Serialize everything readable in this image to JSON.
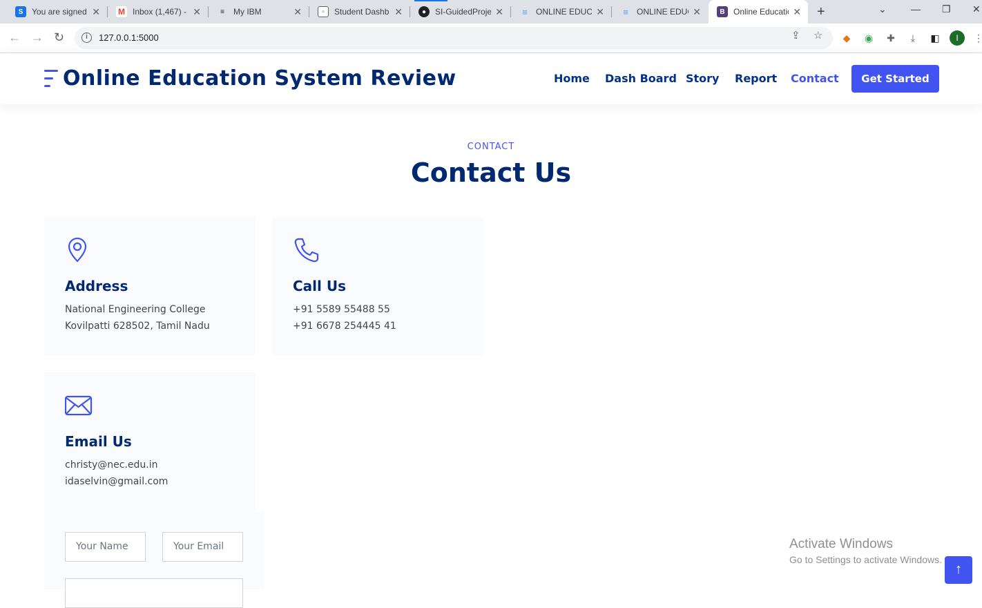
{
  "browser": {
    "tabs": [
      {
        "title": "You are signed",
        "favicon": "S",
        "favicon_color": "#1a73e8"
      },
      {
        "title": "Inbox (1,467) - ",
        "favicon": "M",
        "favicon_color": "#ea4335"
      },
      {
        "title": "My IBM",
        "favicon": "ibm",
        "favicon_color": "#202124"
      },
      {
        "title": "Student Dashb",
        "favicon": "doc",
        "favicon_color": "#5f6368"
      },
      {
        "title": "SI-GuidedProje",
        "favicon": "gh",
        "favicon_color": "#202124"
      },
      {
        "title": "ONLINE EDUCA",
        "favicon": "e",
        "favicon_color": "#4da3ff"
      },
      {
        "title": "ONLINE EDUCA",
        "favicon": "e",
        "favicon_color": "#4da3ff"
      },
      {
        "title": "Online Educatio",
        "favicon": "B",
        "favicon_color": "#563d7c"
      }
    ],
    "url": "127.0.0.1:5000",
    "profile_initial": "I"
  },
  "site": {
    "brand": "Online Education System Review",
    "nav": [
      "Home",
      "Dash Board",
      "Story",
      "Report",
      "Contact"
    ],
    "cta": "Get Started"
  },
  "contact": {
    "kicker": "CONTACT",
    "title": "Contact Us",
    "address": {
      "heading": "Address",
      "line1": "National Engineering College",
      "line2": "Kovilpatti 628502, Tamil Nadu"
    },
    "call": {
      "heading": "Call Us",
      "line1": "+91 5589 55488 55",
      "line2": "+91 6678 254445 41"
    },
    "email": {
      "heading": "Email Us",
      "line1": "christy@nec.edu.in",
      "line2": "idaselvin@gmail.com"
    },
    "form": {
      "name_placeholder": "Your Name",
      "email_placeholder": "Your Email"
    }
  },
  "overlay": {
    "activate_title": "Activate Windows",
    "activate_sub": "Go to Settings to activate Windows."
  },
  "colors": {
    "accent": "#4154f1",
    "navy": "#012970"
  }
}
